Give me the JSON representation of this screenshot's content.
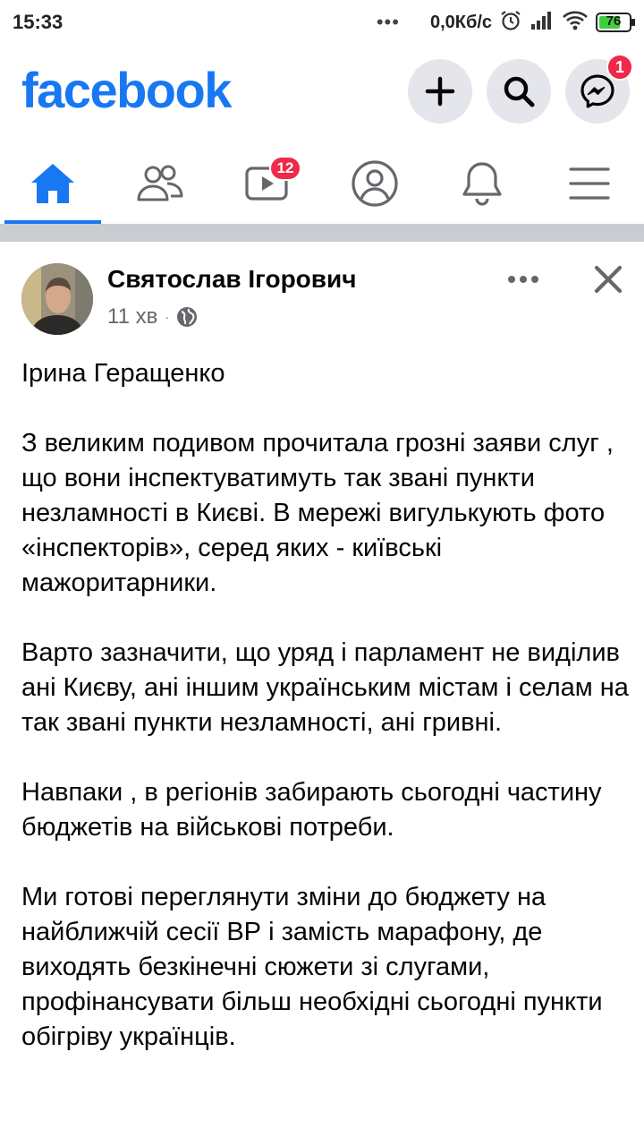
{
  "status_bar": {
    "time": "15:33",
    "more": "•••",
    "speed": "0,0Кб/с",
    "battery": 76,
    "battery_label": "76",
    "icons": [
      "alarm-icon",
      "signal-icon",
      "wifi-icon",
      "battery-icon"
    ]
  },
  "header": {
    "logo": "facebook",
    "brand_color": "#1877f2",
    "actions": [
      "plus-icon",
      "search-icon",
      "messenger-icon"
    ],
    "messenger_badge": "1"
  },
  "nav": {
    "tabs": [
      "home-icon",
      "friends-icon",
      "watch-icon",
      "profile-icon",
      "notifications-icon",
      "menu-icon"
    ],
    "active": "home-icon",
    "watch_badge": "12"
  },
  "post": {
    "author": "Святослав Ігорович",
    "time": "11 хв",
    "separator": "·",
    "audience": "globe-icon",
    "paragraphs": [
      "Ірина Геращенко",
      "З великим подивом прочитала грозні заяви слуг , що вони інспектуватимуть так звані пункти незламності в Києві. В мережі вигулькують фото «інспекторів», серед яких - київські мажоритарники.",
      "Варто зазначити, що уряд і парламент не виділив ані Києву, ані іншим українським містам і селам на так звані пункти незламності, ані гривні.",
      "Навпаки , в регіонів забирають сьогодні частину бюджетів на військові потреби.",
      "Ми готові переглянути зміни до бюджету на найближчій сесії ВР  і замість марафону, де виходять  безкінечні сюжети зі слугами, профінансувати більш необхідні сьогодні пункти обігріву українців."
    ]
  }
}
